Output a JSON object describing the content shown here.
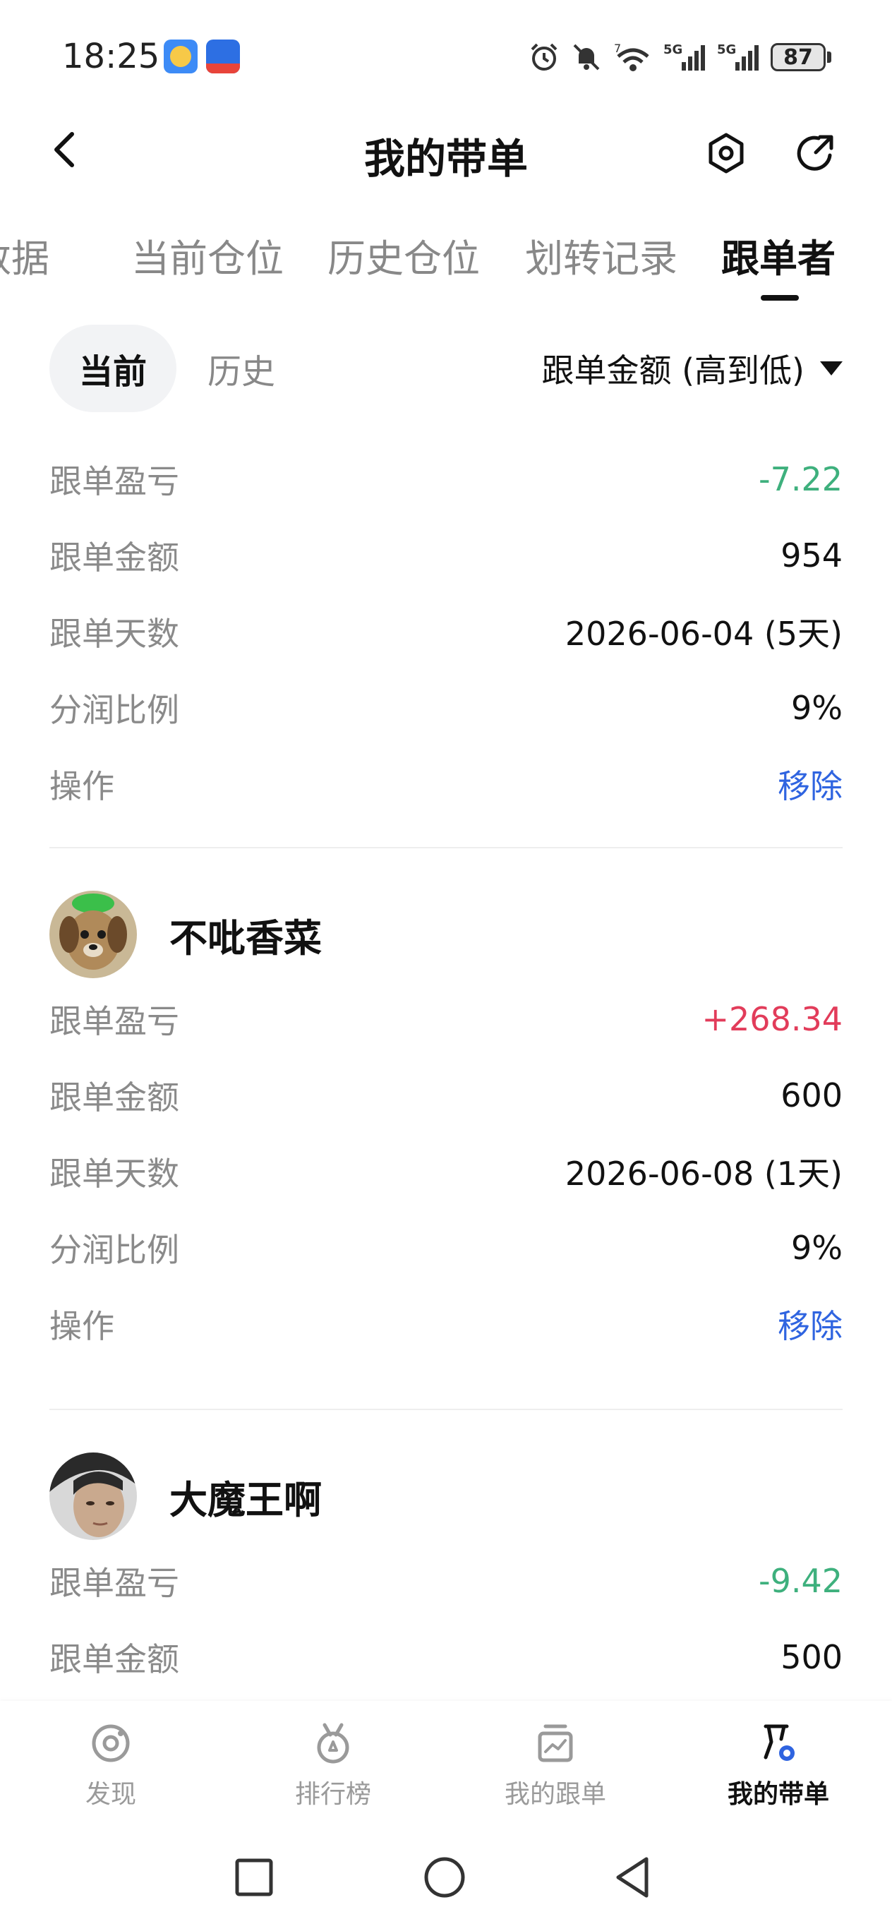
{
  "status_bar": {
    "time": "18:25",
    "network_labels": [
      "7",
      "5G",
      "5G"
    ],
    "battery": "87"
  },
  "header": {
    "title": "我的带单"
  },
  "tabs": [
    {
      "label": "数据"
    },
    {
      "label": "当前仓位"
    },
    {
      "label": "历史仓位"
    },
    {
      "label": "划转记录"
    },
    {
      "label": "跟单者"
    }
  ],
  "filter": {
    "current": "当前",
    "history": "历史",
    "sort": "跟单金额 (高到低)"
  },
  "followers": [
    {
      "name": "",
      "rows": [
        {
          "label": "跟单盈亏",
          "value": "-7.22",
          "tone": "green"
        },
        {
          "label": "跟单金额",
          "value": "954",
          "tone": "normal"
        },
        {
          "label": "跟单天数",
          "value": "2026-06-04 (5天)",
          "tone": "normal"
        },
        {
          "label": "分润比例",
          "value": "9%",
          "tone": "normal"
        },
        {
          "label": "操作",
          "value": "移除",
          "tone": "link"
        }
      ]
    },
    {
      "name": "不吡香菜",
      "rows": [
        {
          "label": "跟单盈亏",
          "value": "+268.34",
          "tone": "red"
        },
        {
          "label": "跟单金额",
          "value": "600",
          "tone": "normal"
        },
        {
          "label": "跟单天数",
          "value": "2026-06-08 (1天)",
          "tone": "normal"
        },
        {
          "label": "分润比例",
          "value": "9%",
          "tone": "normal"
        },
        {
          "label": "操作",
          "value": "移除",
          "tone": "link"
        }
      ]
    },
    {
      "name": "大魔王啊",
      "rows": [
        {
          "label": "跟单盈亏",
          "value": "-9.42",
          "tone": "green"
        },
        {
          "label": "跟单金额",
          "value": "500",
          "tone": "normal"
        }
      ]
    }
  ],
  "bottom_nav": [
    {
      "label": "发现",
      "icon": "discover-icon"
    },
    {
      "label": "排行榜",
      "icon": "ranking-medal-icon"
    },
    {
      "label": "我的跟单",
      "icon": "my-copy-trade-icon"
    },
    {
      "label": "我的带单",
      "icon": "my-lead-trade-icon",
      "active": true
    }
  ],
  "colors": {
    "profit": "#e23c5a",
    "loss": "#3eb07d",
    "link": "#2f64e0"
  }
}
